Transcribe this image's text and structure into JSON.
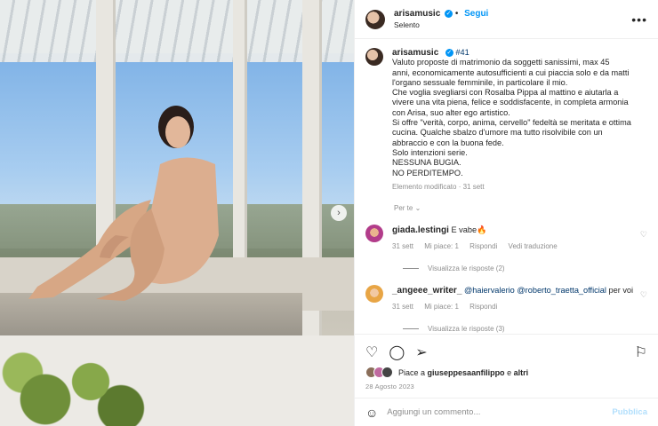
{
  "header": {
    "username": "arisamusic",
    "follow_label": "Segui",
    "location": "Selento",
    "more_icon": "more-horizontal-icon"
  },
  "caption": {
    "username": "arisamusic",
    "hashtag": "#41",
    "lines": [
      "Valuto proposte di matrimonio da soggetti sanissimi, max 45",
      "anni, economicamente autosufficienti a cui piaccia solo e da matti",
      "l'organo sessuale femminile, in particolare il mio.",
      "Che voglia svegliarsi con Rosalba Pippa al mattino e aiutarla a",
      "vivere una vita piena, felice e soddisfacente, in completa armonia",
      "con Arisa, suo alter ego artistico.",
      "Si offre \"verità, corpo, anima, cervello\" fedeltà se meritata e ottima",
      "cucina. Qualche sbalzo d'umore ma tutto risolvibile con un",
      "abbraccio e con la buona fede.",
      "Solo intenzioni serie.",
      "NESSUNA BUGIA.",
      "NO PERDITEMPO."
    ],
    "meta": "Elemento modificato · 31 sett"
  },
  "translate_label": "Per te",
  "comments": [
    {
      "username": "giada.lestingi",
      "text": "E vabe🔥",
      "time": "31 sett",
      "likes": "Mi piace: 1",
      "reply": "Rispondi",
      "translation": "Vedi traduzione",
      "replies": "Visualizza le risposte (2)"
    },
    {
      "username": "_angeee_writer_",
      "mention1": "@haiervalerio",
      "mention2": "@roberto_traetta_official",
      "text": "per voi",
      "time": "31 sett",
      "likes": "Mi piace: 1",
      "reply": "Rispondi",
      "replies": "Visualizza le risposte (3)"
    }
  ],
  "actions": {
    "likes_text_prefix": "Piace a",
    "likes_user": "giuseppesaanfilippo",
    "likes_suffix": "e",
    "likes_others": "altri",
    "date": "28 Agosto 2023"
  },
  "add_comment": {
    "placeholder": "Aggiungi un commento...",
    "publish": "Pubblica"
  },
  "icons": {
    "like": "heart-icon",
    "comment": "comment-icon",
    "share": "send-icon",
    "save": "bookmark-icon",
    "emoji": "emoji-icon",
    "next": "chevron-right-icon"
  },
  "colors": {
    "accent": "#0095f6",
    "muted": "#8e8e8e",
    "text": "#262626"
  }
}
